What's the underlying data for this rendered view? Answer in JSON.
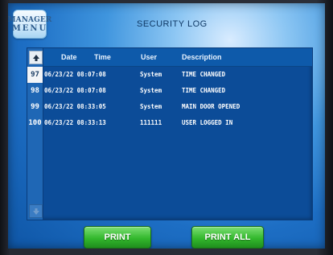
{
  "manager_menu": {
    "line1": "MANAGER",
    "line2": "MENU"
  },
  "title": "SECURITY LOG",
  "columns": {
    "date": "Date",
    "time": "Time",
    "user": "User",
    "description": "Description"
  },
  "rows": [
    {
      "num": "97",
      "datetime": "06/23/22 08:07:08",
      "user": "System",
      "description": "TIME CHANGED"
    },
    {
      "num": "98",
      "datetime": "06/23/22 08:07:08",
      "user": "System",
      "description": "TIME CHANGED"
    },
    {
      "num": "99",
      "datetime": "06/23/22 08:33:05",
      "user": "System",
      "description": "MAIN DOOR OPENED"
    },
    {
      "num": "100",
      "datetime": "06/23/22 08:33:13",
      "user": "111111",
      "description": "USER LOGGED IN"
    }
  ],
  "buttons": {
    "print": "PRINT",
    "print_all": "PRINT ALL"
  },
  "icons": {
    "scroll_up": "arrow-up-icon",
    "scroll_down": "arrow-down-icon"
  },
  "colors": {
    "accent_green": "#33b82d",
    "panel_blue": "#0c4c98"
  }
}
